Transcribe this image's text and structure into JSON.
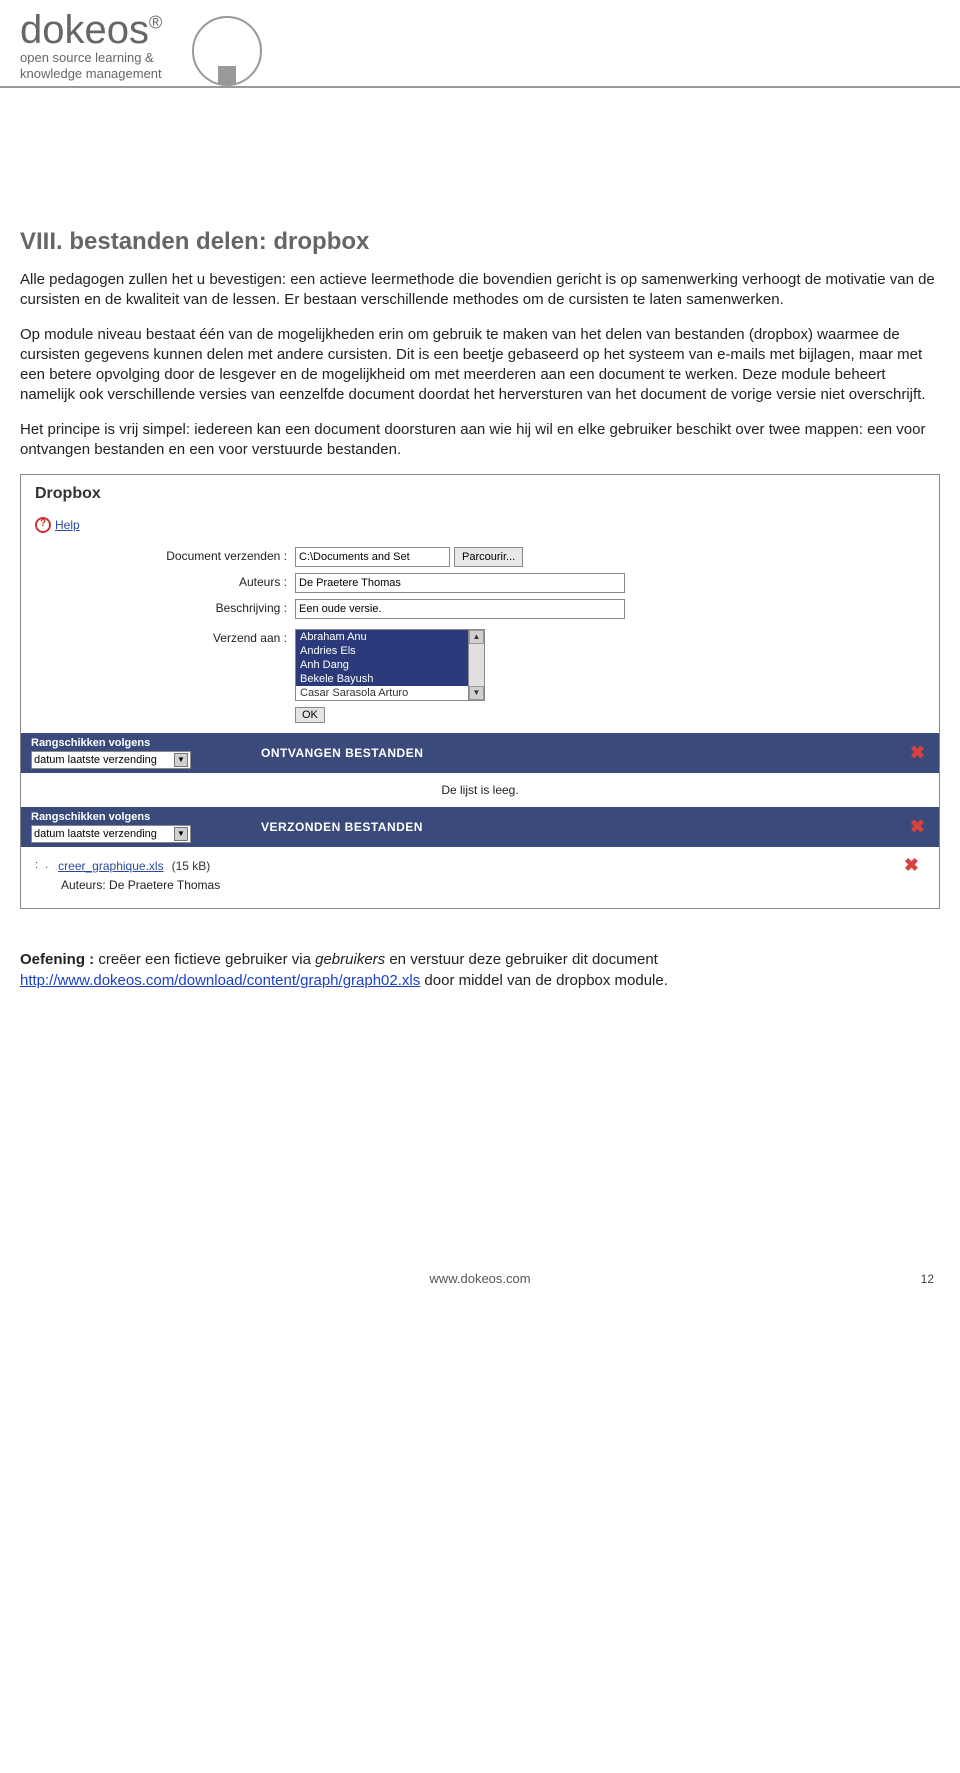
{
  "brand": {
    "name": "dokeos",
    "reg": "®",
    "tagline1": "open source learning &",
    "tagline2": "knowledge management"
  },
  "section": {
    "title": "VIII. bestanden delen: dropbox",
    "p1": "Alle pedagogen zullen het u bevestigen: een actieve leermethode die bovendien gericht is op samenwerking verhoogt de motivatie van de cursisten en de kwaliteit van de lessen. Er bestaan verschillende methodes om de cursisten te laten samenwerken.",
    "p2": "Op module niveau bestaat één van de mogelijkheden erin om gebruik te maken van het delen van bestanden (dropbox) waarmee de cursisten gegevens kunnen delen met andere cursisten. Dit is een beetje gebaseerd op het systeem van e-mails met bijlagen, maar met een betere opvolging door de lesgever en de mogelijkheid om met meerderen aan een document te werken. Deze module beheert namelijk ook verschillende versies van eenzelfde document doordat het herversturen van het document de vorige versie niet overschrijft.",
    "p3": "Het principe is vrij simpel: iedereen kan een document doorsturen aan wie hij wil en elke gebruiker beschikt over twee mappen: een voor ontvangen bestanden en een voor verstuurde bestanden."
  },
  "app": {
    "title": "Dropbox",
    "help": "Help",
    "labels": {
      "document": "Document verzenden :",
      "authors": "Auteurs :",
      "description": "Beschrijving :",
      "sendto": "Verzend aan :"
    },
    "values": {
      "document": "C:\\Documents and Set",
      "browse": "Parcourir...",
      "authors": "De Praetere Thomas",
      "description": "Een oude versie."
    },
    "recipients": [
      "Abraham Anu",
      "Andries Els",
      "Anh Dang",
      "Bekele Bayush",
      "Casar Sarasola Arturo"
    ],
    "ok": "OK",
    "sort_label": "Rangschikken volgens",
    "sort_value": "datum laatste verzending",
    "received_title": "ONTVANGEN BESTANDEN",
    "empty": "De lijst is leeg.",
    "sent_title": "VERZONDEN BESTANDEN",
    "file": {
      "name": "creer_graphique.xls",
      "size": "(15 kB)",
      "author_label": "Auteurs:",
      "author": "De Praetere Thomas"
    }
  },
  "exercise": {
    "lead": "Oefening :",
    "t1": " creëer een fictieve gebruiker via ",
    "em": "gebruikers",
    "t2": " en verstuur deze gebruiker dit document   ",
    "url": "http://www.dokeos.com/download/content/graph/graph02.xls",
    "t3": " door middel van de dropbox module."
  },
  "footer": {
    "site": "www.dokeos.com",
    "page": "12"
  }
}
